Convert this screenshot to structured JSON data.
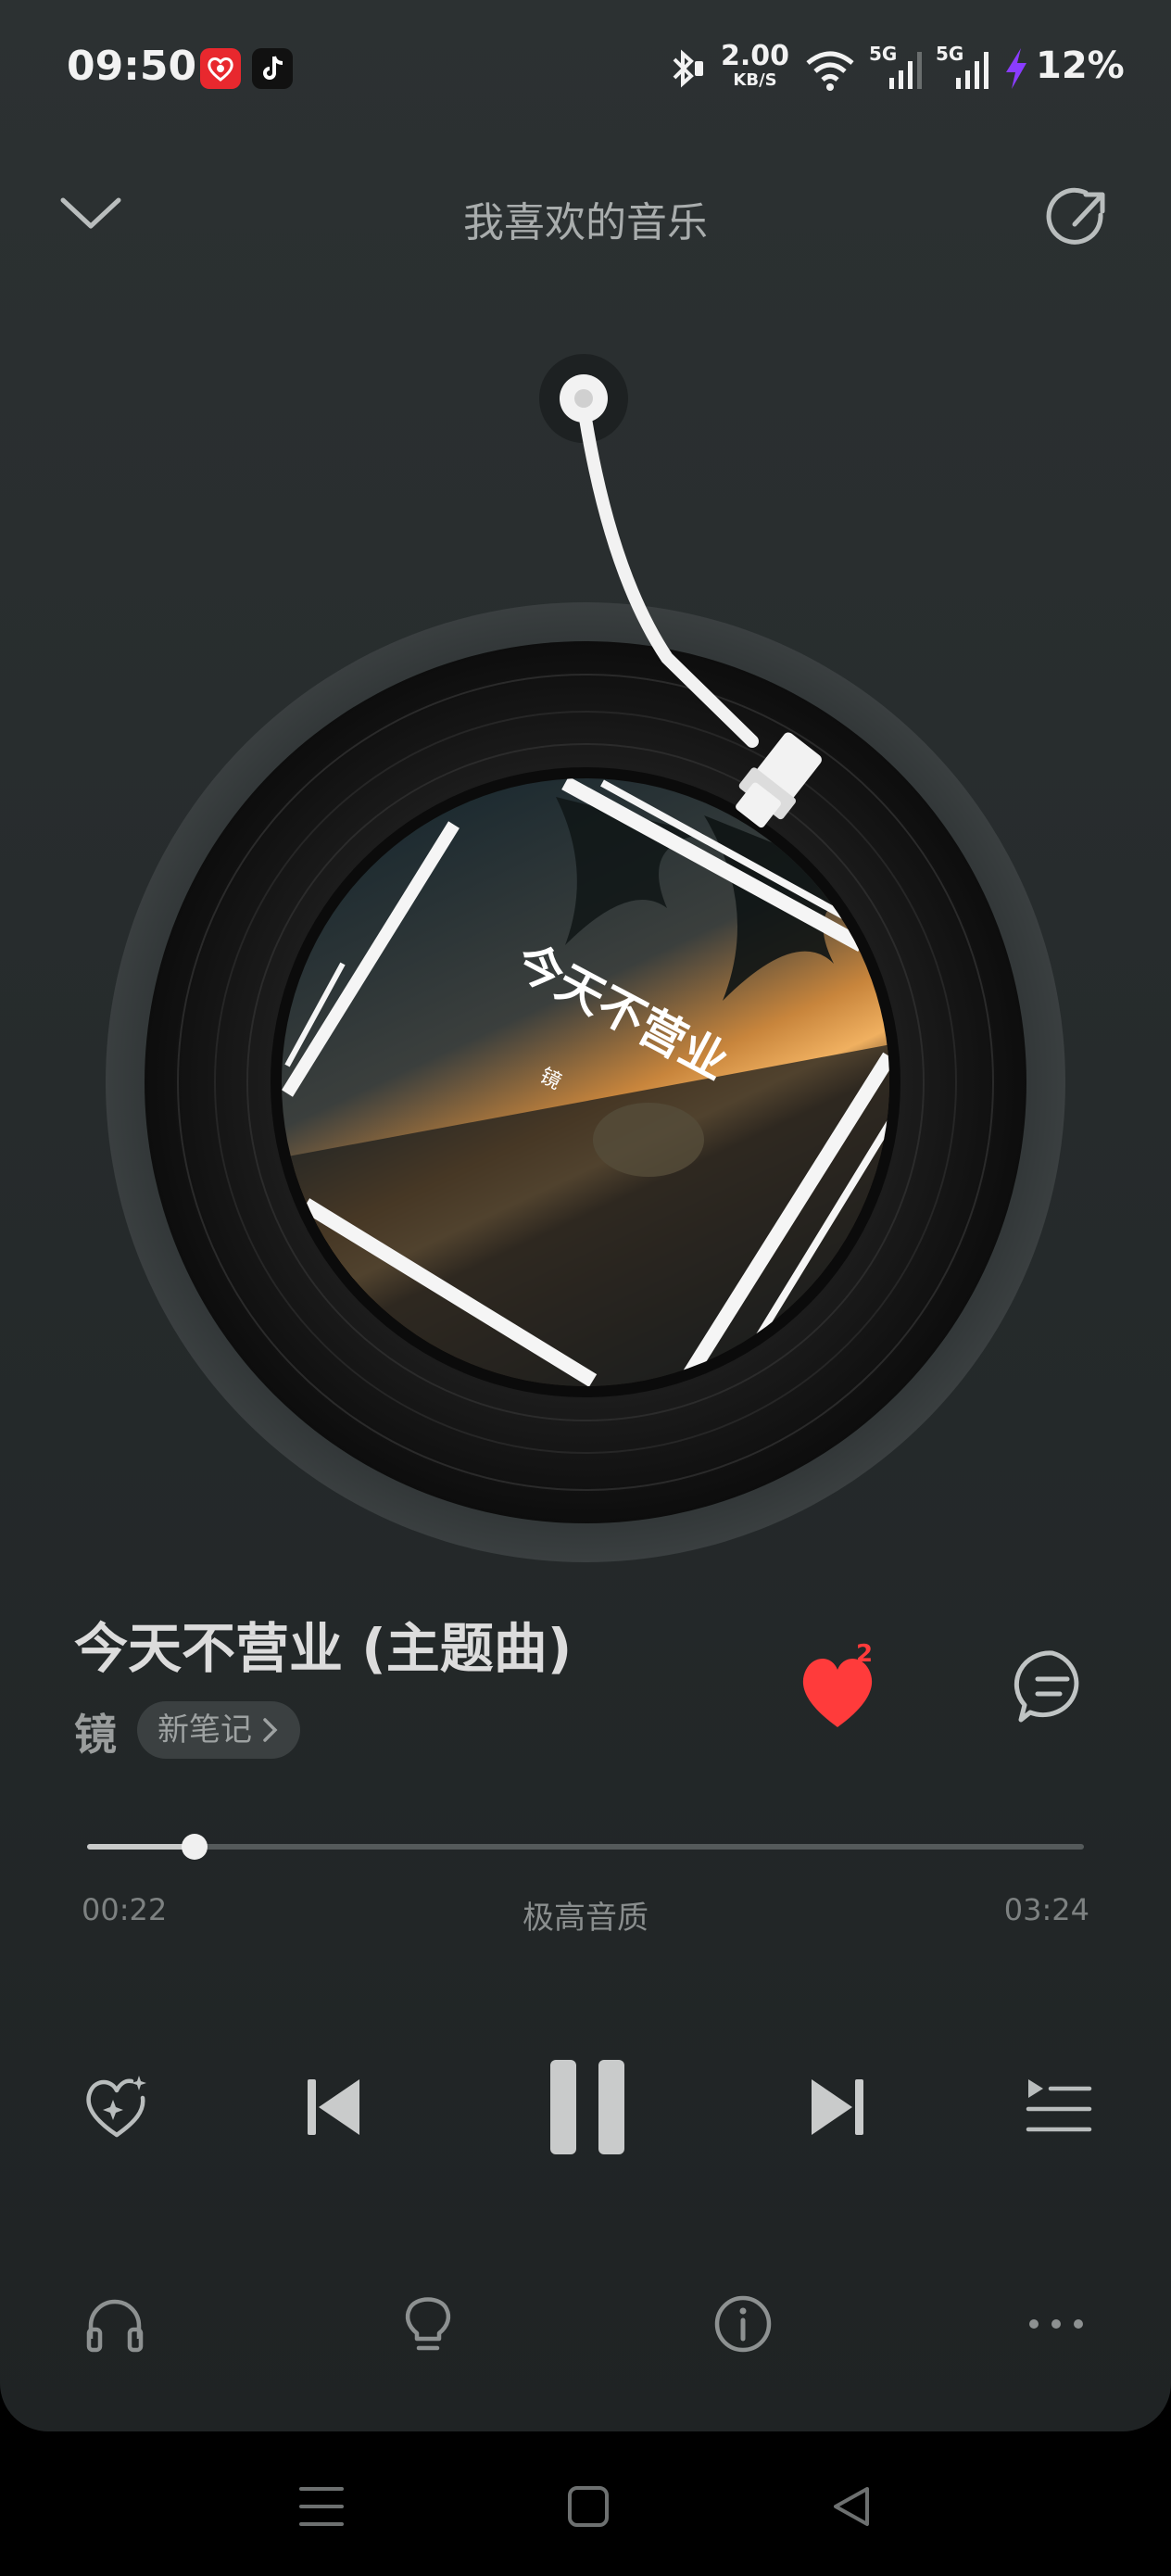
{
  "status_bar": {
    "time": "09:50",
    "net_speed_value": "2.00",
    "net_speed_unit": "KB/S",
    "network_1": "5G",
    "network_2": "5G",
    "battery": "12%",
    "icons": [
      "app-heart-icon",
      "tiktok-icon",
      "bluetooth-icon",
      "wifi-icon",
      "signal-5g-icon",
      "signal-5g-icon",
      "charging-icon"
    ]
  },
  "header": {
    "title": "我喜欢的音乐"
  },
  "cover": {
    "title_text": "今天不营业",
    "small_text": "镜"
  },
  "song": {
    "title": "今天不营业 (主题曲)",
    "artist": "镜",
    "note_chip": "新笔记",
    "like_count": "2"
  },
  "progress": {
    "current": "00:22",
    "total": "03:24",
    "quality": "极高音质",
    "fraction": 0.108
  },
  "controls": [
    "heart-sparkle-icon",
    "previous-icon",
    "pause-icon",
    "next-icon",
    "playlist-icon"
  ],
  "bottom_icons": [
    "headphones-icon",
    "lightbulb-icon",
    "info-icon",
    "more-icon"
  ],
  "colors": {
    "accent_red": "#ff3b3b",
    "background": "#2a2f30"
  }
}
